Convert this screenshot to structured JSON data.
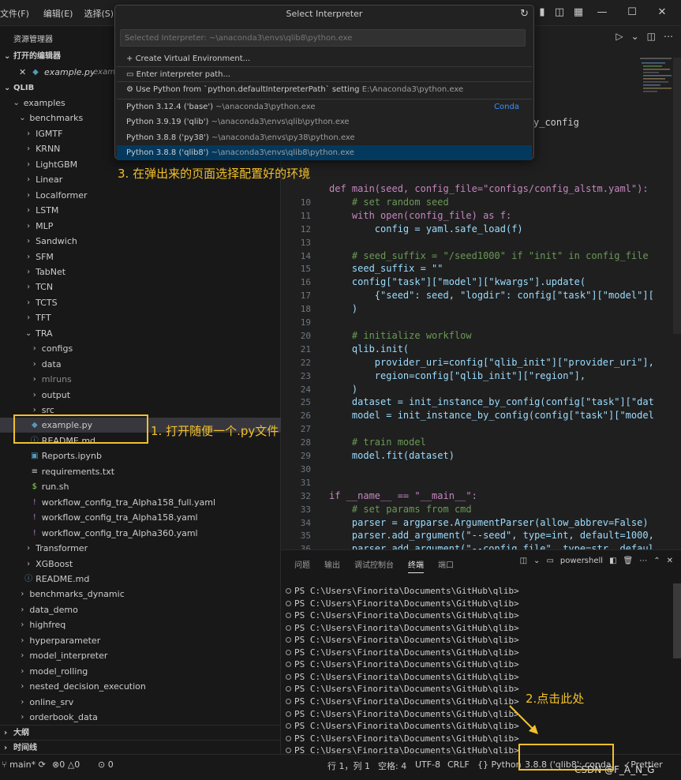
{
  "menu": [
    "文件(F)",
    "编辑(E)",
    "选择(S)"
  ],
  "sidebar": {
    "explorer_title": "资源管理器",
    "open_editors_header": "打开的编辑器",
    "open_editor_file": "example.py",
    "open_editor_path": "exam",
    "workspace_header": "QLIB",
    "outline_header": "大纲",
    "timeline_header": "时间线",
    "tree": [
      {
        "label": "examples",
        "type": "folder",
        "open": true,
        "indent": 1
      },
      {
        "label": "benchmarks",
        "type": "folder",
        "open": true,
        "indent": 2
      },
      {
        "label": "IGMTF",
        "type": "folder",
        "indent": 3
      },
      {
        "label": "KRNN",
        "type": "folder",
        "indent": 3
      },
      {
        "label": "LightGBM",
        "type": "folder",
        "indent": 3
      },
      {
        "label": "Linear",
        "type": "folder",
        "indent": 3
      },
      {
        "label": "Localformer",
        "type": "folder",
        "indent": 3
      },
      {
        "label": "LSTM",
        "type": "folder",
        "indent": 3
      },
      {
        "label": "MLP",
        "type": "folder",
        "indent": 3
      },
      {
        "label": "Sandwich",
        "type": "folder",
        "indent": 3
      },
      {
        "label": "SFM",
        "type": "folder",
        "indent": 3
      },
      {
        "label": "TabNet",
        "type": "folder",
        "indent": 3
      },
      {
        "label": "TCN",
        "type": "folder",
        "indent": 3
      },
      {
        "label": "TCTS",
        "type": "folder",
        "indent": 3
      },
      {
        "label": "TFT",
        "type": "folder",
        "indent": 3
      },
      {
        "label": "TRA",
        "type": "folder",
        "open": true,
        "indent": 3
      },
      {
        "label": "configs",
        "type": "folder",
        "indent": 4
      },
      {
        "label": "data",
        "type": "folder",
        "indent": 4
      },
      {
        "label": "mlruns",
        "type": "folder",
        "indent": 4,
        "dim": true
      },
      {
        "label": "output",
        "type": "folder",
        "indent": 4
      },
      {
        "label": "src",
        "type": "folder",
        "indent": 4
      },
      {
        "label": "example.py",
        "type": "py",
        "indent": 4,
        "selected": true
      },
      {
        "label": "README.md",
        "type": "md",
        "indent": 4
      },
      {
        "label": "Reports.ipynb",
        "type": "ipynb",
        "indent": 4
      },
      {
        "label": "requirements.txt",
        "type": "txt",
        "indent": 4
      },
      {
        "label": "run.sh",
        "type": "sh",
        "indent": 4
      },
      {
        "label": "workflow_config_tra_Alpha158_full.yaml",
        "type": "yaml",
        "indent": 4
      },
      {
        "label": "workflow_config_tra_Alpha158.yaml",
        "type": "yaml",
        "indent": 4
      },
      {
        "label": "workflow_config_tra_Alpha360.yaml",
        "type": "yaml",
        "indent": 4
      },
      {
        "label": "Transformer",
        "type": "folder",
        "indent": 3
      },
      {
        "label": "XGBoost",
        "type": "folder",
        "indent": 3
      },
      {
        "label": "README.md",
        "type": "md",
        "indent": 3
      },
      {
        "label": "benchmarks_dynamic",
        "type": "folder",
        "indent": 2
      },
      {
        "label": "data_demo",
        "type": "folder",
        "indent": 2
      },
      {
        "label": "highfreq",
        "type": "folder",
        "indent": 2
      },
      {
        "label": "hyperparameter",
        "type": "folder",
        "indent": 2
      },
      {
        "label": "model_interpreter",
        "type": "folder",
        "indent": 2
      },
      {
        "label": "model_rolling",
        "type": "folder",
        "indent": 2
      },
      {
        "label": "nested_decision_execution",
        "type": "folder",
        "indent": 2
      },
      {
        "label": "online_srv",
        "type": "folder",
        "indent": 2
      },
      {
        "label": "orderbook_data",
        "type": "folder",
        "indent": 2
      }
    ]
  },
  "quick_pick": {
    "title": "Select Interpreter",
    "placeholder": "Selected Interpreter: ~\\anaconda3\\envs\\qlib8\\python.exe",
    "items": [
      {
        "icon": "plus-icon",
        "label": "Create Virtual Environment...",
        "desc": ""
      },
      {
        "icon": "folder-icon",
        "label": "Enter interpreter path...",
        "desc": ""
      },
      {
        "icon": "gear-icon",
        "label": "Use Python from `python.defaultInterpreterPath` setting",
        "desc": "E:\\Anaconda3\\python.exe"
      },
      {
        "icon": "",
        "label": "Python 3.12.4 ('base')",
        "desc": "~\\anaconda3\\python.exe",
        "badge": "Conda"
      },
      {
        "icon": "",
        "label": "Python 3.9.19 ('qlib')",
        "desc": "~\\anaconda3\\envs\\qlib\\python.exe"
      },
      {
        "icon": "",
        "label": "Python 3.8.8 ('py38')",
        "desc": "~\\anaconda3\\envs\\py38\\python.exe"
      },
      {
        "icon": "",
        "label": "Python 3.8.8 ('qlib8')",
        "desc": "~\\anaconda3\\envs\\qlib8\\python.exe",
        "active": true
      }
    ]
  },
  "editor": {
    "partial_line_top": "y_config",
    "lines": [
      {
        "n": "",
        "t": "def main(seed, config_file=\"configs/config_alstm.yaml\"):"
      },
      {
        "n": "10",
        "t": "    # set random seed"
      },
      {
        "n": "11",
        "t": "    with open(config_file) as f:"
      },
      {
        "n": "12",
        "t": "        config = yaml.safe_load(f)"
      },
      {
        "n": "13",
        "t": ""
      },
      {
        "n": "14",
        "t": "    # seed_suffix = \"/seed1000\" if \"init\" in config_file"
      },
      {
        "n": "15",
        "t": "    seed_suffix = \"\""
      },
      {
        "n": "16",
        "t": "    config[\"task\"][\"model\"][\"kwargs\"].update("
      },
      {
        "n": "17",
        "t": "        {\"seed\": seed, \"logdir\": config[\"task\"][\"model\"]["
      },
      {
        "n": "18",
        "t": "    )"
      },
      {
        "n": "19",
        "t": ""
      },
      {
        "n": "20",
        "t": "    # initialize workflow"
      },
      {
        "n": "21",
        "t": "    qlib.init("
      },
      {
        "n": "22",
        "t": "        provider_uri=config[\"qlib_init\"][\"provider_uri\"],"
      },
      {
        "n": "23",
        "t": "        region=config[\"qlib_init\"][\"region\"],"
      },
      {
        "n": "24",
        "t": "    )"
      },
      {
        "n": "25",
        "t": "    dataset = init_instance_by_config(config[\"task\"][\"dat"
      },
      {
        "n": "26",
        "t": "    model = init_instance_by_config(config[\"task\"][\"model"
      },
      {
        "n": "27",
        "t": ""
      },
      {
        "n": "28",
        "t": "    # train model"
      },
      {
        "n": "29",
        "t": "    model.fit(dataset)"
      },
      {
        "n": "30",
        "t": ""
      },
      {
        "n": "31",
        "t": ""
      },
      {
        "n": "32",
        "t": "if __name__ == \"__main__\":"
      },
      {
        "n": "33",
        "t": "    # set params from cmd"
      },
      {
        "n": "34",
        "t": "    parser = argparse.ArgumentParser(allow_abbrev=False)"
      },
      {
        "n": "35",
        "t": "    parser.add_argument(\"--seed\", type=int, default=1000,"
      },
      {
        "n": "36",
        "t": "    parser.add_argument(\"--config_file\", type=str, defaul"
      },
      {
        "n": "37",
        "t": "    args = parser.parse_args()"
      },
      {
        "n": "38",
        "t": "    main(**vars(args))"
      }
    ]
  },
  "panel": {
    "tabs": [
      "问题",
      "输出",
      "调试控制台",
      "终端",
      "端口"
    ],
    "active_tab": "终端",
    "terminal_name": "powershell",
    "prompt": "PS C:\\Users\\Finorita\\Documents\\GitHub\\qlib>",
    "prompt_count": 14
  },
  "statusbar": {
    "branch": "main*",
    "errors": "0",
    "warnings": "0",
    "ports": "0",
    "position": "行 1，列 1",
    "spaces": "空格: 4",
    "encoding": "UTF-8",
    "eol": "CRLF",
    "language": "Python",
    "interpreter": "3.8.8 ('qlib8': conda)",
    "prettier": "Prettier"
  },
  "annotations": {
    "step1": "1. 打开随便一个.py文件",
    "step2": "2.点击此处",
    "step3": "3. 在弹出来的页面选择配置好的环境"
  },
  "watermark": "CSDN @F_A_N_G",
  "colors": {
    "accent": "#04395e",
    "annotation": "#f2c02a",
    "badge": "#3794ff"
  }
}
